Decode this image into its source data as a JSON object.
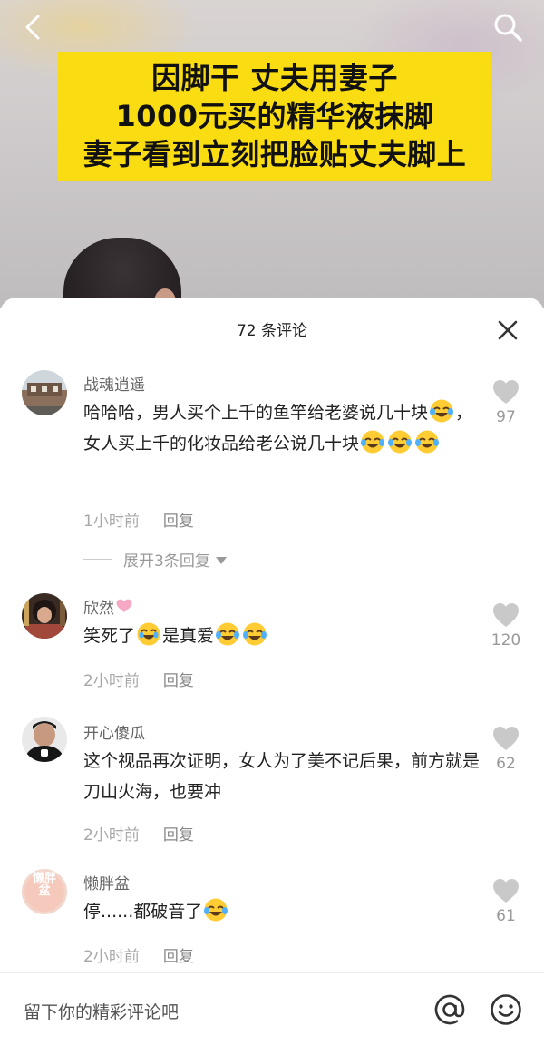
{
  "video": {
    "caption_lines": [
      "因脚干 丈夫用妻子",
      "1000元买的精华液抹脚",
      "妻子看到立刻把脸贴丈夫脚上"
    ],
    "back_icon": "chevron-left-icon",
    "search_icon": "search-icon"
  },
  "comments_panel": {
    "title": "72 条评论",
    "close_icon": "close-icon",
    "comments": [
      {
        "author": "战魂逍遥",
        "text_parts": [
          "哈哈哈，男人买个上千的鱼竿给老婆说几十块",
          "，女人买上千的化妆品给老公说几十块"
        ],
        "time": "1小时前",
        "reply_label": "回复",
        "likes": "97",
        "expand_label": "展开3条回复"
      },
      {
        "author": "欣然",
        "text_parts": [
          "笑死了",
          "是真爱"
        ],
        "time": "2小时前",
        "reply_label": "回复",
        "likes": "120"
      },
      {
        "author": "开心傻瓜",
        "text_parts": [
          "这个视品再次证明，女人为了美不记后果，前方就是刀山火海，也要冲"
        ],
        "time": "2小时前",
        "reply_label": "回复",
        "likes": "62"
      },
      {
        "author": "懒胖盆",
        "avatar_text": "懒胖盆",
        "text_parts": [
          "停......都破音了"
        ],
        "time": "2小时前",
        "reply_label": "回复",
        "likes": "61"
      }
    ]
  },
  "input": {
    "placeholder": "留下你的精彩评论吧",
    "at_icon": "at-icon",
    "emoji_icon": "emoji-icon"
  },
  "colors": {
    "caption_bg": "#f9dc11",
    "like_icon": "#c9c9c9",
    "meta_text": "#a8a8a8",
    "badge_heart": "#f7a8c4"
  }
}
